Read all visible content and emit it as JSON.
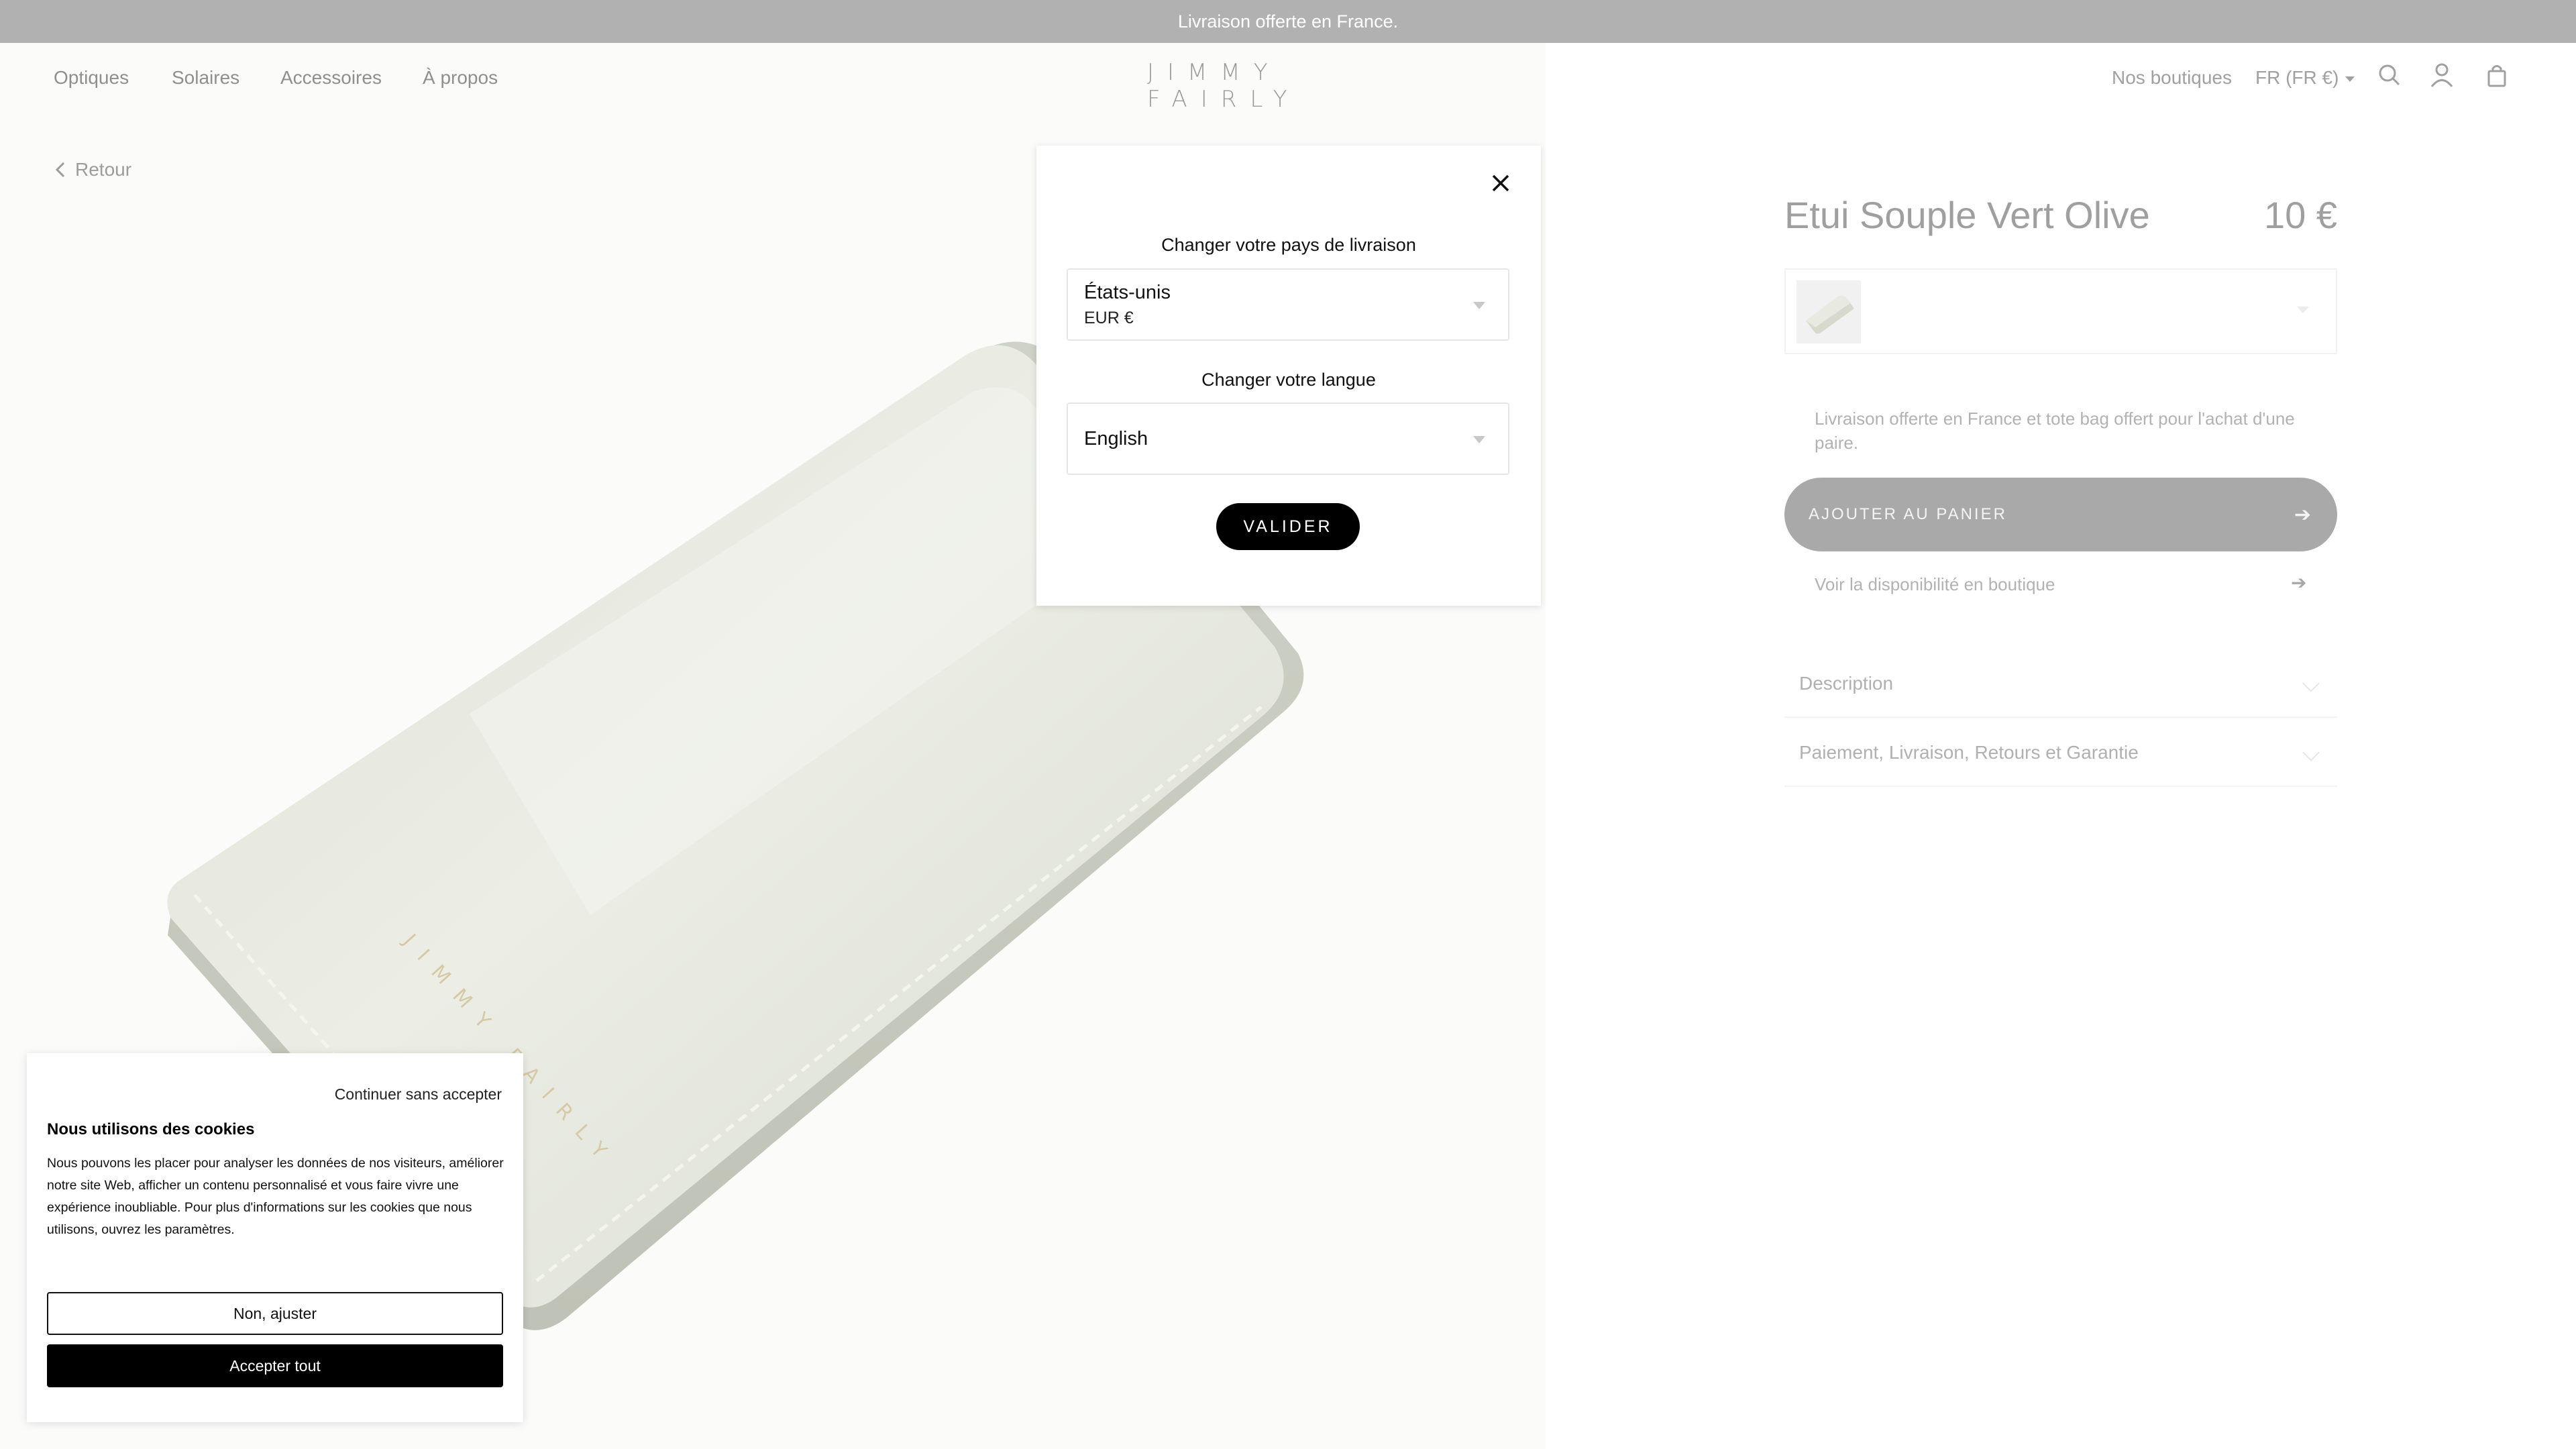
{
  "promo": {
    "text": "Livraison offerte en France."
  },
  "header": {
    "nav": [
      "Optiques",
      "Solaires",
      "Accessoires",
      "À propos"
    ],
    "logo": "JIMMY FAIRLY",
    "stores": "Nos boutiques",
    "locale": "FR (FR €)",
    "icons": [
      "search-icon",
      "account-icon",
      "bag-icon"
    ]
  },
  "back": {
    "label": "Retour"
  },
  "product": {
    "title": "Etui Souple Vert Olive",
    "price": "10 €",
    "shipping_note": "Livraison offerte en France et tote bag offert pour l'achat d'une paire.",
    "add_to_cart": "AJOUTER AU PANIER",
    "store_availability": "Voir la disponibilité en boutique",
    "accordions": [
      "Description",
      "Paiement, Livraison, Retours et Garantie"
    ],
    "image_logo_text": "JIMMY FAIRLY"
  },
  "modal": {
    "country_label": "Changer votre pays de livraison",
    "country_value": "États-unis",
    "currency_value": "EUR €",
    "language_label": "Changer votre langue",
    "language_value": "English",
    "submit": "VALIDER"
  },
  "cookie": {
    "skip": "Continuer sans accepter",
    "title": "Nous utilisons des cookies",
    "body": "Nous pouvons les placer pour analyser les données de nos visiteurs, améliorer notre site Web, afficher un contenu personnalisé et vous faire vivre une expérience inoubliable. Pour plus d'informations sur les cookies que nous utilisons, ouvrez les paramètres.",
    "adjust": "Non, ajuster",
    "accept": "Accepter tout"
  },
  "colors": {
    "promo_bg": "#b1b1b1",
    "button_black": "#000000",
    "dimmed_button": "#a9a9a9",
    "case_color": "#e4e6dd"
  }
}
